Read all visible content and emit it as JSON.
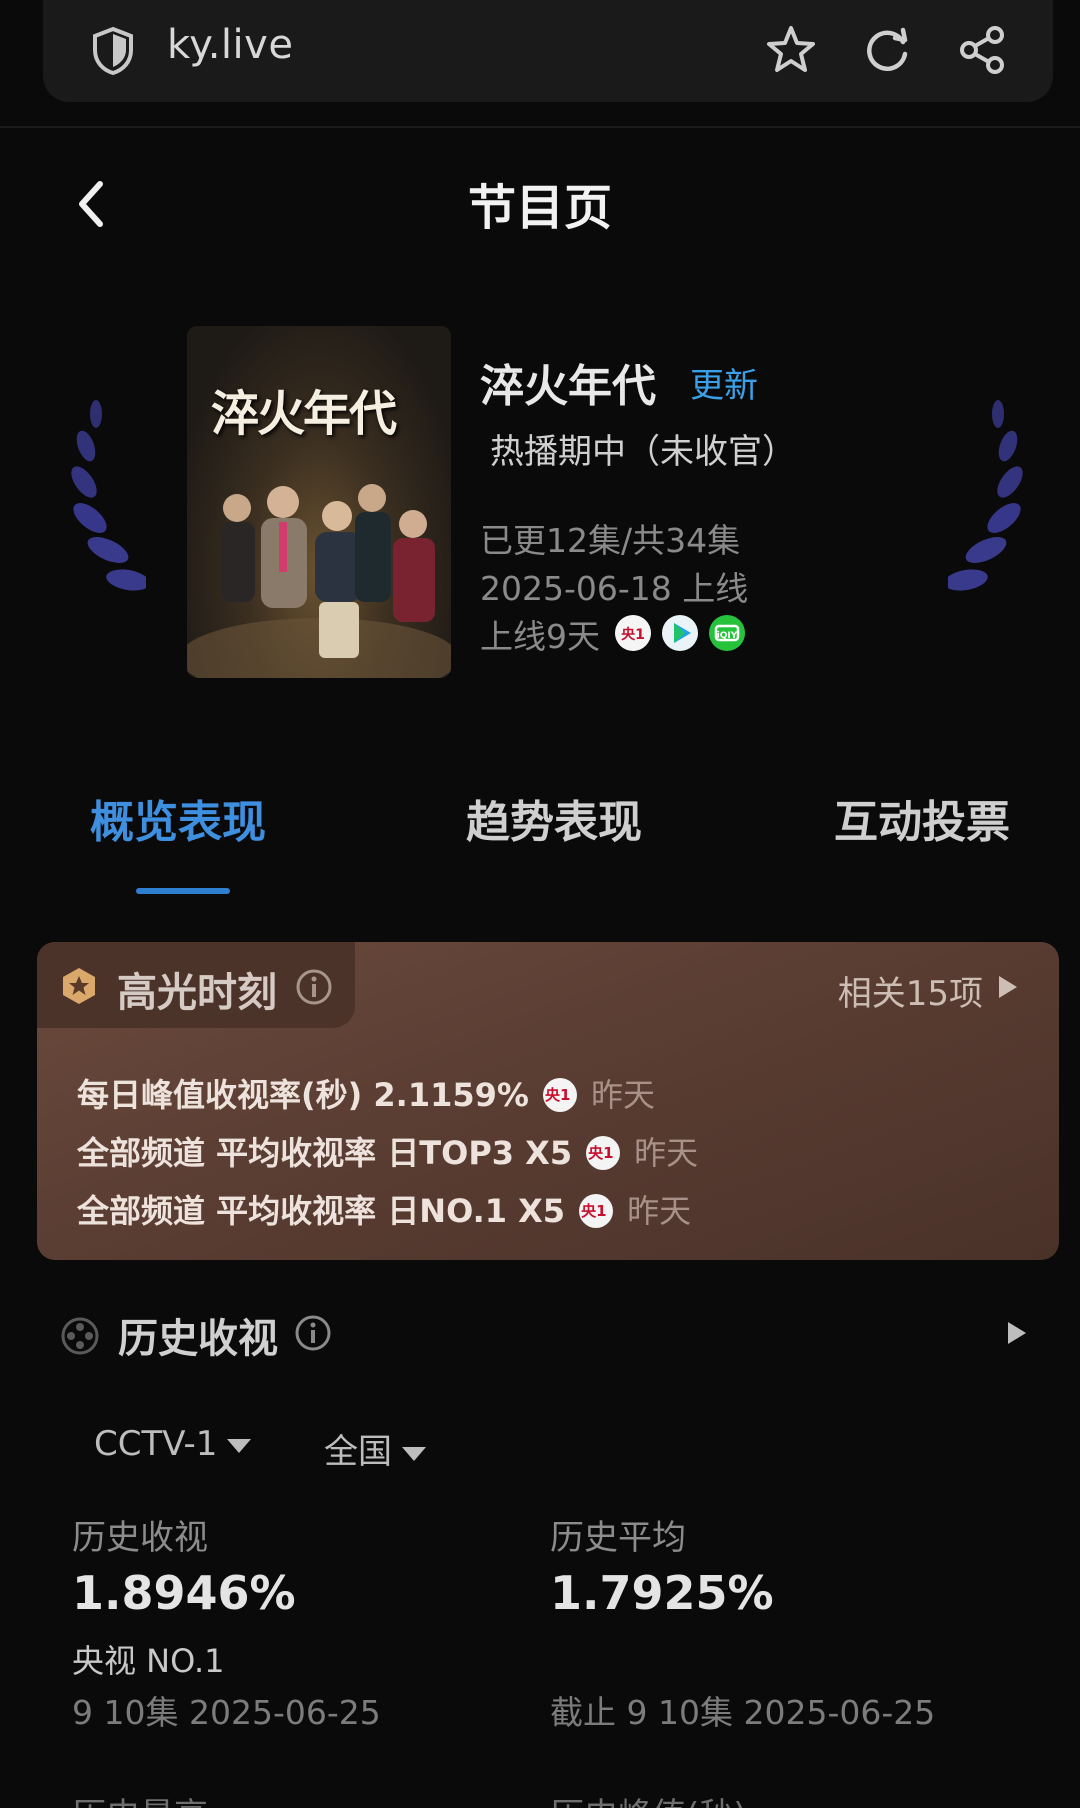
{
  "browser": {
    "url": "ky.live"
  },
  "header": {
    "title": "节目页"
  },
  "show": {
    "title": "淬火年代",
    "poster_title": "淬火年代",
    "update_badge": "更新",
    "status": "热播期中（未收官）",
    "episodes": "已更12集/共34集",
    "release": "2025-06-18 上线",
    "days_online": "上线9天",
    "platforms": [
      "cctv1-icon",
      "tencent-video-icon",
      "iqiyi-icon"
    ]
  },
  "tabs": [
    {
      "label": "概览表现",
      "active": true
    },
    {
      "label": "趋势表现",
      "active": false
    },
    {
      "label": "互动投票",
      "active": false
    }
  ],
  "highlights": {
    "title": "高光时刻",
    "related": "相关15项",
    "rows": [
      {
        "text": "每日峰值收视率(秒) 2.1159%",
        "when": "昨天"
      },
      {
        "text": "全部频道 平均收视率  日TOP3 X5",
        "when": "昨天"
      },
      {
        "text": "全部频道 平均收视率  日NO.1 X5",
        "when": "昨天"
      }
    ]
  },
  "history": {
    "title": "历史收视",
    "channel": "CCTV-1",
    "region": "全国",
    "stats": [
      {
        "label": "历史收视",
        "value": "1.8946%",
        "sub": "央视 NO.1",
        "date": "9 10集 2025-06-25"
      },
      {
        "label": "历史平均",
        "value": "1.7925%",
        "sub": "",
        "date": "截止 9 10集 2025-06-25"
      }
    ],
    "next_labels": [
      "历史最高",
      "历史峰值(秒)"
    ]
  },
  "colors": {
    "accent": "#3f8fe0",
    "background": "#0a0a0a",
    "highlight_card": "#5a3d33",
    "laurel": "#3a3a8c"
  }
}
